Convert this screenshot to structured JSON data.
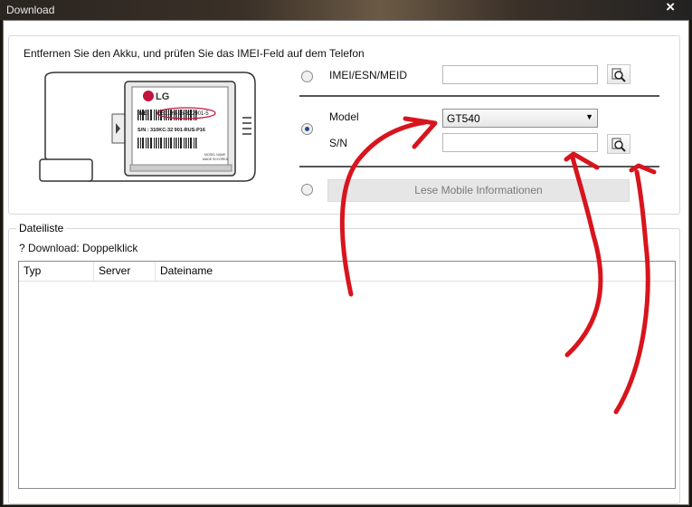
{
  "window": {
    "title": "Download"
  },
  "instruction": "Entfernen Sie den Akku, und prüfen Sie das IMEI-Feld auf dem Telefon",
  "phone_label": {
    "brand": "LG",
    "imei_label": "IMEI",
    "imei_value": "351199-26-322901-5",
    "sn_line": "S/N : 310KC-32 901-RUS-P16",
    "model_name": "MODEL NAME",
    "made_in": "MADE IN KOREA"
  },
  "options": {
    "imei_label": "IMEI/ESN/MEID",
    "imei_value": "",
    "model_label": "Model",
    "model_value": "GT540",
    "sn_label": "S/N",
    "sn_value": "",
    "read_button": "Lese Mobile Informationen"
  },
  "filelist": {
    "legend": "Dateiliste",
    "hint": "? Download: Doppelklick",
    "columns": [
      "Typ",
      "Server",
      "Dateiname"
    ]
  },
  "colors": {
    "annotation": "#d8141c",
    "disabled_text": "#7a7a7a"
  }
}
